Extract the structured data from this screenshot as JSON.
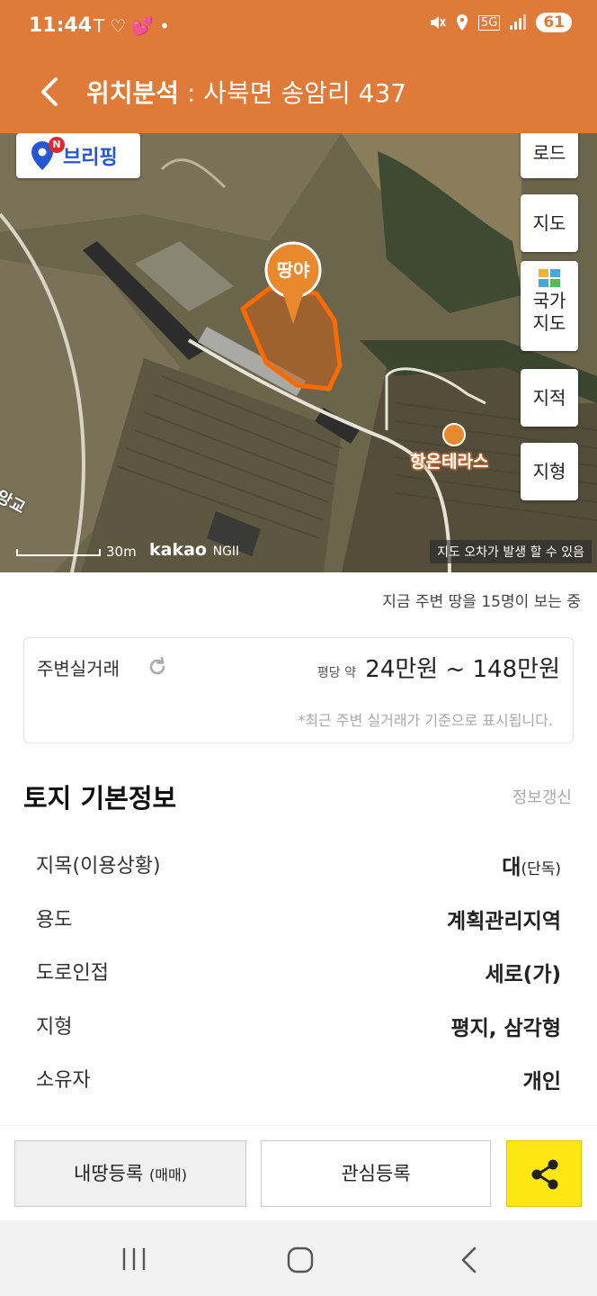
{
  "status_bar": {
    "time": "11:44",
    "left_icons": [
      "T",
      "♡",
      "💕",
      "•"
    ],
    "network": "5G",
    "battery": "61"
  },
  "header": {
    "title_bold": "위치분석",
    "title_rest": " : 사북면 송암리 437"
  },
  "map": {
    "briefing_badge": "N",
    "briefing_label": "브리핑",
    "buttons": {
      "road": "로드",
      "jido": "지도",
      "national_line1": "국가",
      "national_line2": "지도",
      "jijeok": "지적",
      "jihyung": "지형"
    },
    "marker_label": "땅야",
    "poi_name": "항온테라스",
    "road_label": "앙교",
    "scale_label": "30m",
    "brand": "kakao",
    "brand_sub": "NGII",
    "error_note": "지도 오차가 발생 할 수 있음"
  },
  "viewers_text": "지금 주변 땅을 15명이 보는 중",
  "price_card": {
    "label": "주변실거래",
    "unit_prefix": "평당 약",
    "price_range": "24만원 ~ 148만원",
    "note": "*최근 주변 실거래가 기준으로 표시됩니다."
  },
  "land_info": {
    "title": "토지 기본정보",
    "refresh_label": "정보갱신",
    "rows": [
      {
        "key": "지목(이용상황)",
        "value": "대",
        "value_sub": "(단독)"
      },
      {
        "key": "용도",
        "value": "계획관리지역",
        "value_sub": ""
      },
      {
        "key": "도로인접",
        "value": "세로(가)",
        "value_sub": ""
      },
      {
        "key": "지형",
        "value": "평지, 삼각형",
        "value_sub": ""
      },
      {
        "key": "소유자",
        "value": "개인",
        "value_sub": ""
      }
    ]
  },
  "bottom_bar": {
    "register_label": "내땅등록",
    "register_sub": "(매매)",
    "interest_label": "관심등록",
    "share_icon": "share-icon"
  },
  "nav_bar": {
    "icons": [
      "recent-apps-icon",
      "home-icon",
      "back-icon"
    ]
  },
  "colors": {
    "header_orange": "#e07a38",
    "marker_orange": "#e8892e",
    "share_yellow": "#ffe812",
    "briefing_blue": "#2456d6"
  }
}
